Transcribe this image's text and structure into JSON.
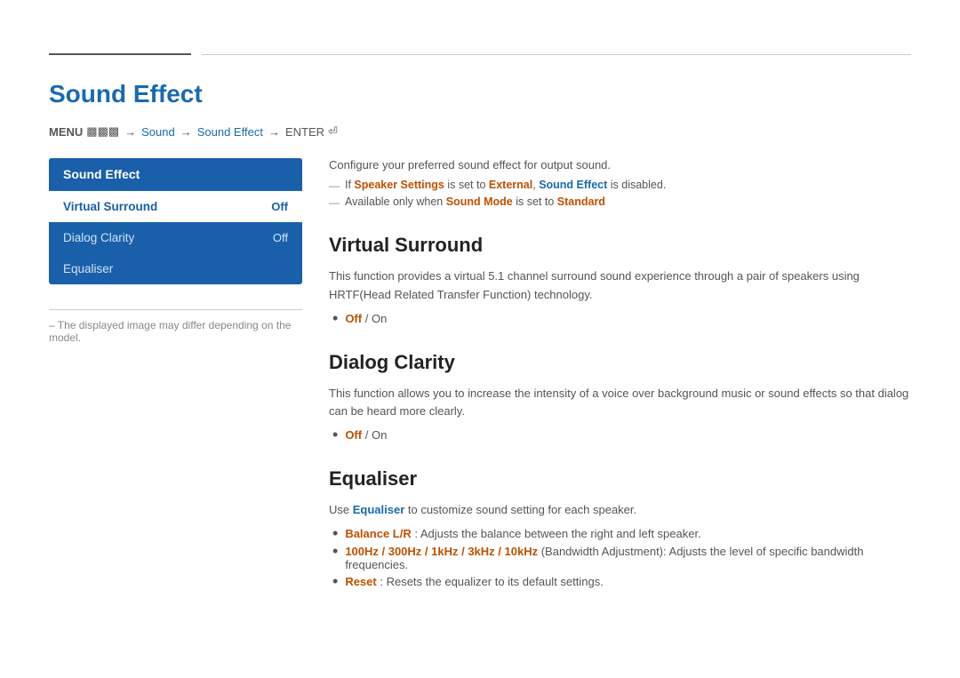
{
  "page": {
    "title": "Sound Effect",
    "top_divider_short": true,
    "breadcrumb": {
      "menu": "MENU",
      "arrow1": "→",
      "sound": "Sound",
      "arrow2": "→",
      "soundeffect": "Sound Effect",
      "arrow3": "→",
      "enter": "ENTER"
    }
  },
  "left_panel": {
    "menu_header": "Sound Effect",
    "items": [
      {
        "label": "Virtual Surround",
        "value": "Off",
        "active": true
      },
      {
        "label": "Dialog Clarity",
        "value": "Off",
        "active": false
      },
      {
        "label": "Equaliser",
        "value": "",
        "active": false
      }
    ],
    "note": "The displayed image may differ depending on the model."
  },
  "right_panel": {
    "intro": "Configure your preferred sound effect for output sound.",
    "notes": [
      {
        "part1": "If ",
        "link1": "Speaker Settings",
        "part2": " is set to ",
        "link2": "External",
        "part3": ", ",
        "link3": "Sound Effect",
        "part4": " is disabled."
      },
      {
        "part1": "Available only when ",
        "link1": "Sound Mode",
        "part2": " is set to ",
        "link2": "Standard"
      }
    ],
    "sections": [
      {
        "id": "virtual-surround",
        "title": "Virtual Surround",
        "desc": "This function provides a virtual 5.1 channel surround sound experience through a pair of speakers using HRTF(Head Related Transfer Function) technology.",
        "bullets": [
          {
            "text": "Off / On",
            "type": "off-on"
          }
        ]
      },
      {
        "id": "dialog-clarity",
        "title": "Dialog Clarity",
        "desc": "This function allows you to increase the intensity of a voice over background music or sound effects so that dialog can be heard more clearly.",
        "bullets": [
          {
            "text": "Off / On",
            "type": "off-on"
          }
        ]
      },
      {
        "id": "equaliser",
        "title": "Equaliser",
        "desc_prefix": "Use ",
        "desc_link": "Equaliser",
        "desc_suffix": " to customize sound setting for each speaker.",
        "bullets": [
          {
            "link": "Balance L/R",
            "text": ": Adjusts the balance between the right and left speaker.",
            "type": "link-text"
          },
          {
            "link": "100Hz / 300Hz / 1kHz / 3kHz / 10kHz",
            "text": " (Bandwidth Adjustment): Adjusts the level of specific bandwidth frequencies.",
            "type": "link-text"
          },
          {
            "link": "Reset",
            "text": ": Resets the equalizer to its default settings.",
            "type": "link-text"
          }
        ]
      }
    ]
  }
}
